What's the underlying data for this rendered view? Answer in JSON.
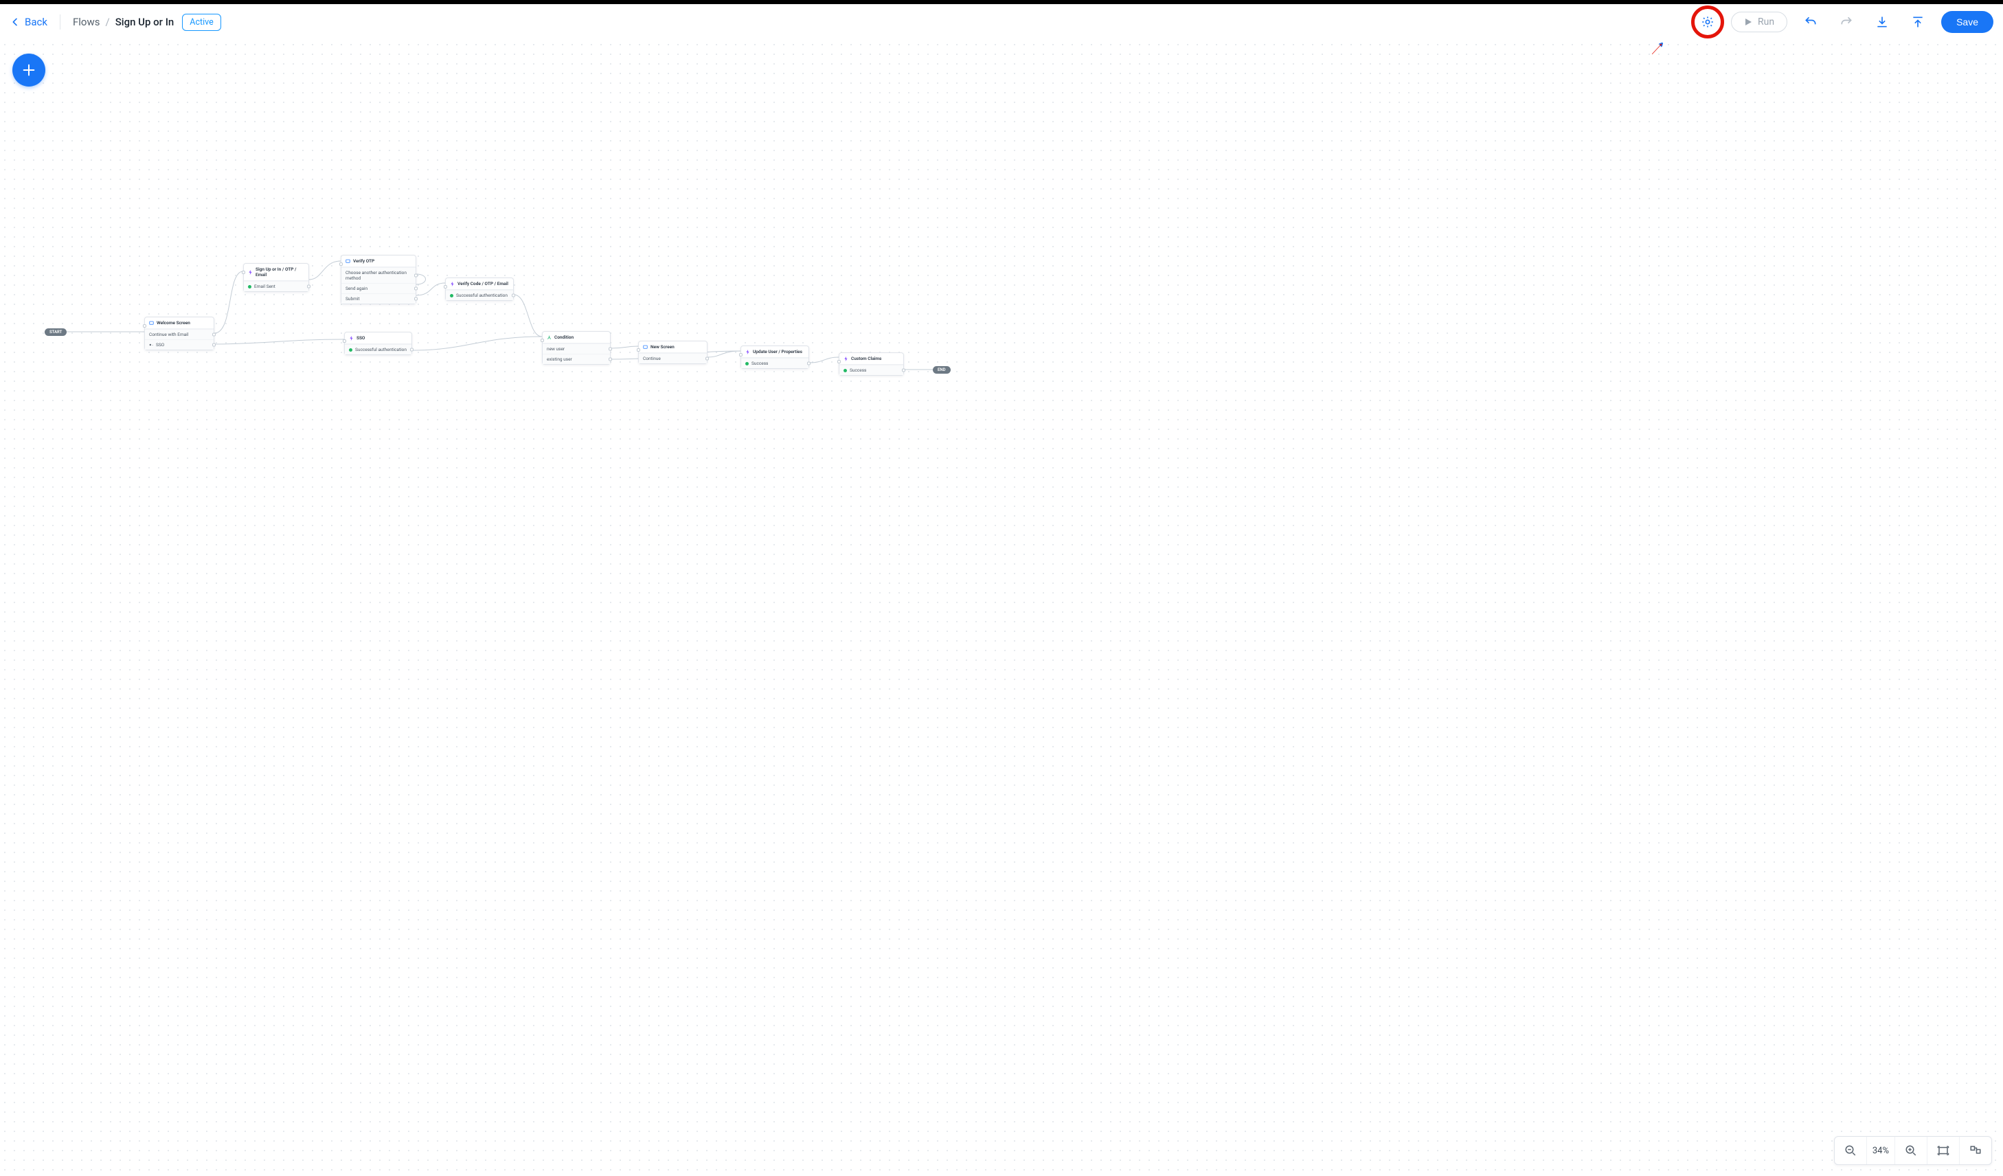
{
  "header": {
    "back_label": "Back",
    "breadcrumb_root": "Flows",
    "breadcrumb_current": "Sign Up or In",
    "status": "Active",
    "run_label": "Run",
    "save_label": "Save"
  },
  "zoom": {
    "percent": "34%"
  },
  "pills": {
    "start": "START",
    "end": "END"
  },
  "nodes": {
    "welcome": {
      "title": "Welcome Screen",
      "rows": [
        "Continue with Email",
        "SSO"
      ]
    },
    "signup_email": {
      "title": "Sign Up or In / OTP / Email",
      "rows": [
        "Email Sent"
      ]
    },
    "verify_otp": {
      "title": "Verify OTP",
      "rows": [
        "Choose another authentication method",
        "Send again",
        "Submit"
      ]
    },
    "sso": {
      "title": "SSO",
      "rows": [
        "Successful authentication"
      ]
    },
    "verify_code": {
      "title": "Verify Code / OTP / Email",
      "rows": [
        "Successful authentication"
      ]
    },
    "condition": {
      "title": "Condition",
      "rows": [
        "new user",
        "existing user"
      ]
    },
    "new_screen": {
      "title": "New Screen",
      "rows": [
        "Continue"
      ]
    },
    "update_user": {
      "title": "Update User / Properties",
      "rows": [
        "Success"
      ]
    },
    "custom_claims": {
      "title": "Custom Claims",
      "rows": [
        "Success"
      ]
    }
  }
}
